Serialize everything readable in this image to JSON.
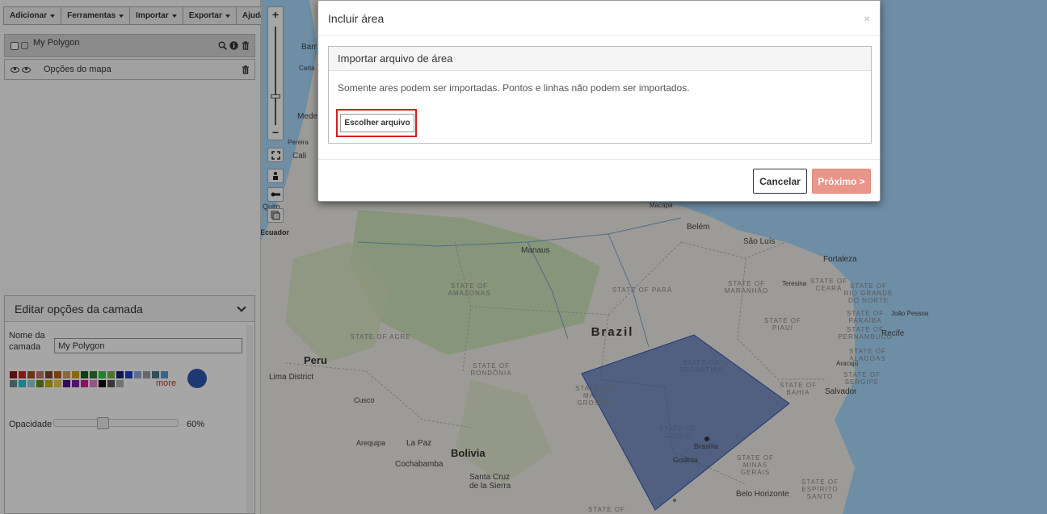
{
  "toolbar": {
    "add": "Adicionar",
    "tools": "Ferramentas",
    "import": "Importar",
    "export": "Exportar",
    "help": "Ajuda"
  },
  "layers": {
    "polygon_label": "My Polygon",
    "map_options_label": "Opções do mapa"
  },
  "edit_panel": {
    "title": "Editar opções da camada",
    "name_label": "Nome da camada",
    "name_value": "My Polygon",
    "more_label": "more",
    "opacity_label": "Opacidade",
    "opacity_value": "60%",
    "opacity_fraction": 0.6,
    "selected_color": "#2f56b0",
    "palette": [
      "#8b1a1a",
      "#c62828",
      "#a0522d",
      "#c0786e",
      "#7b4b2a",
      "#b5651d",
      "#d2a062",
      "#d4a017",
      "#1b5e20",
      "#2e7d32",
      "#2ecc40",
      "#7cb342",
      "#1a237e",
      "#1e3fcc",
      "#8fa8e0",
      "#9e9e9e",
      "#4a7a8c",
      "#5b9bd5",
      "#5f8f8f",
      "#26c6da",
      "#9ad3d3",
      "#6b8e23",
      "#c8b400",
      "#e5d14a",
      "#4a148c",
      "#7b1fa2",
      "#d81b9a",
      "#e880d8",
      "#000000",
      "#555555",
      "#b0b0b0"
    ]
  },
  "map": {
    "labels": [
      {
        "id": "brazil",
        "text": "Brazil"
      },
      {
        "id": "peru",
        "text": "Peru"
      },
      {
        "id": "bolivia",
        "text": "Bolivia"
      },
      {
        "id": "ecuador",
        "text": "Ecuador"
      },
      {
        "id": "manaus",
        "text": "Manaus"
      },
      {
        "id": "belem",
        "text": "Belém"
      },
      {
        "id": "saoluis",
        "text": "São Luís"
      },
      {
        "id": "fortaleza",
        "text": "Fortaleza"
      },
      {
        "id": "teresina",
        "text": "Teresina"
      },
      {
        "id": "recife",
        "text": "Recife"
      },
      {
        "id": "joaopessoa",
        "text": "João Pessoa"
      },
      {
        "id": "aracaju",
        "text": "Aracaju"
      },
      {
        "id": "salvador",
        "text": "Salvador"
      },
      {
        "id": "brasilia",
        "text": "Brasília"
      },
      {
        "id": "goiania",
        "text": "Goiânia"
      },
      {
        "id": "belohorizonte",
        "text": "Belo Horizonte"
      },
      {
        "id": "limadistrict",
        "text": "Lima District"
      },
      {
        "id": "cusco",
        "text": "Cusco"
      },
      {
        "id": "arequipa",
        "text": "Arequipa"
      },
      {
        "id": "lapaz",
        "text": "La Paz"
      },
      {
        "id": "cochabamba",
        "text": "Cochabamba"
      },
      {
        "id": "santacruz1",
        "text": "Santa Cruz"
      },
      {
        "id": "santacruz2",
        "text": "de la Sierra"
      },
      {
        "id": "macapa",
        "text": "Macapá"
      },
      {
        "id": "cali",
        "text": "Cali"
      },
      {
        "id": "quito",
        "text": "Quito"
      },
      {
        "id": "medellin",
        "text": "Mede"
      },
      {
        "id": "pereira",
        "text": "Pereira"
      },
      {
        "id": "barr",
        "text": "Barr"
      },
      {
        "id": "carta",
        "text": "Carta"
      },
      {
        "id": "amazonas",
        "text": "STATE OF AMAZONAS"
      },
      {
        "id": "para",
        "text": "STATE OF PARÁ"
      },
      {
        "id": "maranhao",
        "text": "STATE OF MARANHÃO"
      },
      {
        "id": "ceara",
        "text": "STATE OF CEARÁ"
      },
      {
        "id": "rgn",
        "text": "STATE OF RIO GRANDE DO NORTE"
      },
      {
        "id": "paraiba",
        "text": "STATE OF PARAÍBA"
      },
      {
        "id": "piaui",
        "text": "STATE OF PIAUÍ"
      },
      {
        "id": "pernambuco",
        "text": "STATE OF PERNAMBUCO"
      },
      {
        "id": "alagoas",
        "text": "STATE OF ALAGOAS"
      },
      {
        "id": "sergipe",
        "text": "STATE OF SERGIPE"
      },
      {
        "id": "bahia",
        "text": "STATE OF BAHIA"
      },
      {
        "id": "acre",
        "text": "STATE OF ACRE"
      },
      {
        "id": "rondonia",
        "text": "STATE OF RONDÔNIA"
      },
      {
        "id": "matogrosso",
        "text": "STATE OF MATO GROSSO"
      },
      {
        "id": "tocantins",
        "text": "STATE OF TOCANTINS"
      },
      {
        "id": "goias",
        "text": "STATE OF GOIÁS"
      },
      {
        "id": "minas",
        "text": "STATE OF MINAS GERAIS"
      },
      {
        "id": "espirito",
        "text": "STATE OF ESPÍRITO SANTO"
      },
      {
        "id": "bottom",
        "text": "STATE OF"
      }
    ]
  },
  "modal": {
    "title": "Incluir área",
    "close": "×",
    "panel_title": "Importar arquivo de área",
    "info_text": "Somente ares podem ser importadas. Pontos e linhas não podem ser importados.",
    "choose_file": "Escolher arquivo",
    "cancel": "Cancelar",
    "next": "Próximo >"
  },
  "colors": {
    "water": "#aadaff",
    "land": "#f2efe9",
    "forest": "#c5e3b0",
    "polygon": "#2f56b0",
    "next_button": "#e8968a",
    "highlight": "#d81e1e"
  }
}
